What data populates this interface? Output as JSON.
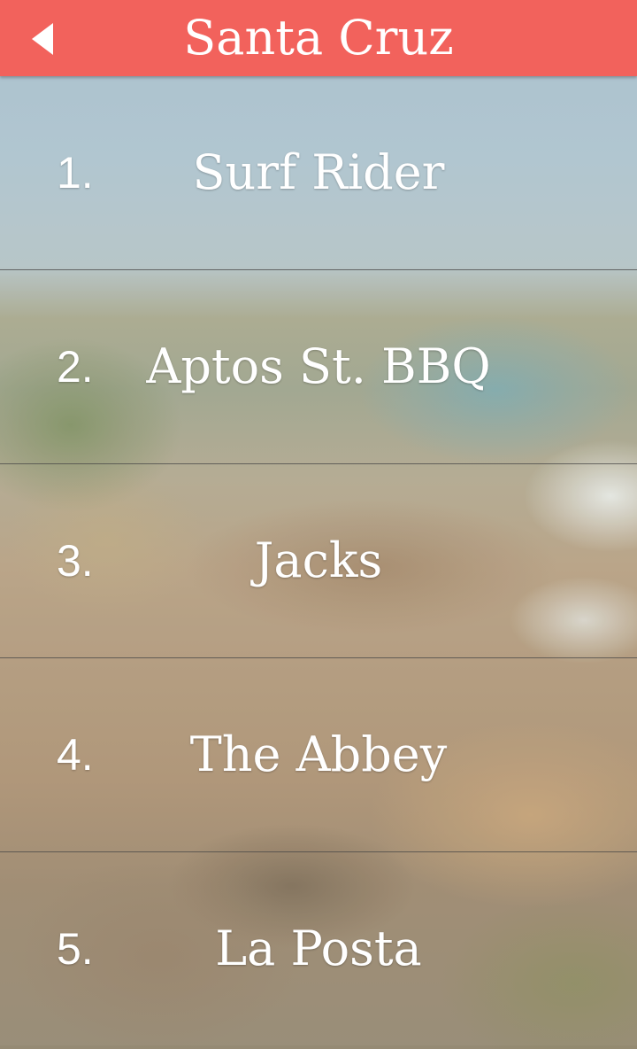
{
  "header": {
    "title": "Santa Cruz",
    "back_icon": "back-arrow-icon",
    "background_color": "#f2625c"
  },
  "list": {
    "items": [
      {
        "number": "1.",
        "name": "Surf Rider"
      },
      {
        "number": "2.",
        "name": "Aptos St. BBQ"
      },
      {
        "number": "3.",
        "name": "Jacks"
      },
      {
        "number": "4.",
        "name": "The Abbey"
      },
      {
        "number": "5.",
        "name": "La Posta"
      }
    ]
  }
}
